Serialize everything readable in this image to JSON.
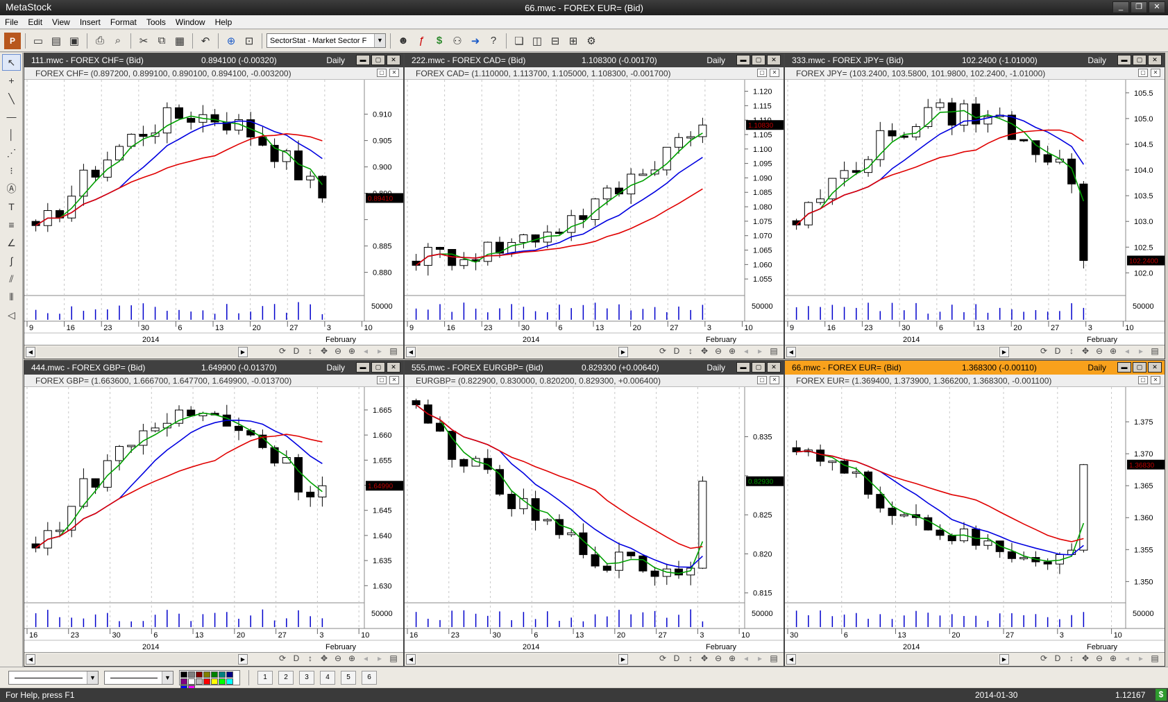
{
  "app": {
    "name": "MetaStock",
    "document_title": "66.mwc - FOREX EUR= (Bid)",
    "window_buttons": [
      "_",
      "❐",
      "✕"
    ]
  },
  "menu": [
    "File",
    "Edit",
    "View",
    "Insert",
    "Format",
    "Tools",
    "Window",
    "Help"
  ],
  "toolbar": {
    "sector_select": "SectorStat - Market Sector F"
  },
  "windows": [
    {
      "id": "chf",
      "title": "111.mwc - FOREX CHF= (Bid)",
      "quote": "0.894100 (-0.00320)",
      "period": "Daily",
      "active": false,
      "legend": "FOREX CHF= (0.897200, 0.899100, 0.890100, 0.894100, -0.003200)",
      "last_label": "0.89410",
      "volume_label": "50000",
      "year_label": "2014",
      "month_label": "February",
      "chart_data": {
        "type": "candlestick",
        "ylim": [
          0.876,
          0.916
        ],
        "yticks": [
          0.88,
          0.885,
          0.89,
          0.895,
          0.9,
          0.905,
          0.91
        ],
        "ytick_labels": [
          "0.880",
          "0.885",
          "",
          "0.890",
          "0.900",
          "0.905",
          "0.910"
        ],
        "xtick_labels": [
          "9",
          "16",
          "23",
          "30",
          "6",
          "13",
          "20",
          "27",
          "3",
          "10"
        ],
        "start": 0.887,
        "end": 0.8941,
        "peak": 0.91,
        "trough": 0.885
      }
    },
    {
      "id": "cad",
      "title": "222.mwc - FOREX CAD= (Bid)",
      "quote": "1.108300 (-0.00170)",
      "period": "Daily",
      "active": false,
      "legend": "FOREX CAD= (1.110000, 1.113700, 1.105000, 1.108300, -0.001700)",
      "last_label": "1.10830",
      "volume_label": "50000",
      "year_label": "2014",
      "month_label": "February",
      "chart_data": {
        "type": "candlestick",
        "ylim": [
          1.05,
          1.123
        ],
        "yticks": [
          1.055,
          1.06,
          1.065,
          1.07,
          1.075,
          1.08,
          1.085,
          1.09,
          1.095,
          1.1,
          1.105,
          1.11,
          1.115,
          1.12
        ],
        "ytick_labels": [
          "1.055",
          "1.060",
          "1.065",
          "1.070",
          "1.075",
          "1.080",
          "1.085",
          "1.090",
          "1.095",
          "1.100",
          "1.105",
          "1.110",
          "1.115",
          "1.120"
        ],
        "xtick_labels": [
          "9",
          "16",
          "23",
          "30",
          "6",
          "13",
          "20",
          "27",
          "3",
          "10"
        ],
        "start": 1.063,
        "end": 1.1083,
        "peak": 1.113,
        "trough": 1.061
      }
    },
    {
      "id": "jpy",
      "title": "333.mwc - FOREX JPY= (Bid)",
      "quote": "102.2400 (-1.01000)",
      "period": "Daily",
      "active": false,
      "legend": "FOREX JPY= (103.2400, 103.5800, 101.9800, 102.2400, -1.01000)",
      "last_label": "102.2400",
      "volume_label": "50000",
      "year_label": "2014",
      "month_label": "February",
      "chart_data": {
        "type": "candlestick",
        "ylim": [
          101.6,
          105.7
        ],
        "yticks": [
          102.0,
          102.5,
          103.0,
          103.5,
          104.0,
          104.5,
          105.0,
          105.5
        ],
        "ytick_labels": [
          "102.0",
          "102.5",
          "103.0",
          "103.5",
          "104.0",
          "104.5",
          "105.0",
          "105.5"
        ],
        "xtick_labels": [
          "9",
          "16",
          "23",
          "30",
          "6",
          "13",
          "20",
          "27",
          "3",
          "10"
        ],
        "start": 103.0,
        "end": 102.24,
        "peak": 105.1,
        "trough": 102.2
      }
    },
    {
      "id": "gbp",
      "title": "444.mwc - FOREX GBP= (Bid)",
      "quote": "1.649900 (-0.01370)",
      "period": "Daily",
      "active": false,
      "legend": "FOREX GBP= (1.663600, 1.666700, 1.647700, 1.649900, -0.013700)",
      "last_label": "1.64990",
      "volume_label": "50000",
      "year_label": "2014",
      "month_label": "February",
      "chart_data": {
        "type": "candlestick",
        "ylim": [
          1.627,
          1.669
        ],
        "yticks": [
          1.63,
          1.635,
          1.64,
          1.645,
          1.65,
          1.655,
          1.66,
          1.665
        ],
        "ytick_labels": [
          "1.630",
          "1.635",
          "1.640",
          "1.645",
          "",
          "1.655",
          "1.660",
          "1.665"
        ],
        "xtick_labels": [
          "16",
          "23",
          "30",
          "6",
          "13",
          "20",
          "27",
          "3",
          "10"
        ],
        "start": 1.637,
        "end": 1.6499,
        "peak": 1.664,
        "trough": 1.634
      }
    },
    {
      "id": "eurgbp",
      "title": "555.mwc - FOREX EURGBP= (Bid)",
      "quote": "0.829300 (+0.00640)",
      "period": "Daily",
      "active": false,
      "legend": "EURGBP= (0.822900, 0.830000, 0.820200, 0.829300, +0.006400)",
      "last_label": "0.82930",
      "volume_label": "50000",
      "year_label": "2014",
      "month_label": "February",
      "chart_data": {
        "type": "candlestick",
        "ylim": [
          0.814,
          0.841
        ],
        "yticks": [
          0.815,
          0.82,
          0.825,
          0.83,
          0.835
        ],
        "ytick_labels": [
          "0.815",
          "0.820",
          "0.825",
          "",
          "0.835"
        ],
        "xtick_labels": [
          "16",
          "23",
          "30",
          "6",
          "13",
          "20",
          "27",
          "3",
          "10"
        ],
        "start": 0.838,
        "end": 0.8293,
        "peak": 0.839,
        "trough": 0.818
      }
    },
    {
      "id": "eur",
      "title": "66.mwc - FOREX EUR= (Bid)",
      "quote": "1.368300 (-0.00110)",
      "period": "Daily",
      "active": true,
      "legend": "FOREX EUR= (1.369400, 1.373900, 1.366200, 1.368300, -0.001100)",
      "last_label": "1.36830",
      "volume_label": "50000",
      "year_label": "2014",
      "month_label": "February",
      "chart_data": {
        "type": "candlestick",
        "ylim": [
          1.347,
          1.38
        ],
        "yticks": [
          1.35,
          1.355,
          1.36,
          1.365,
          1.37,
          1.375
        ],
        "ytick_labels": [
          "1.350",
          "1.355",
          "1.360",
          "1.365",
          "1.370",
          "1.375"
        ],
        "xtick_labels": [
          "30",
          "6",
          "13",
          "20",
          "27",
          "3",
          "10"
        ],
        "start": 1.372,
        "end": 1.3683,
        "peak": 1.373,
        "trough": 1.354
      }
    }
  ],
  "status": {
    "help": "For Help, press F1",
    "date": "2014-01-30",
    "value": "1.12167",
    "dollar": "$"
  },
  "colors": {
    "accent_active": "#f8a11c",
    "ma_fast": "#00a000",
    "ma_mid": "#0000e0",
    "ma_slow": "#e00000",
    "volume": "#0000cc"
  }
}
